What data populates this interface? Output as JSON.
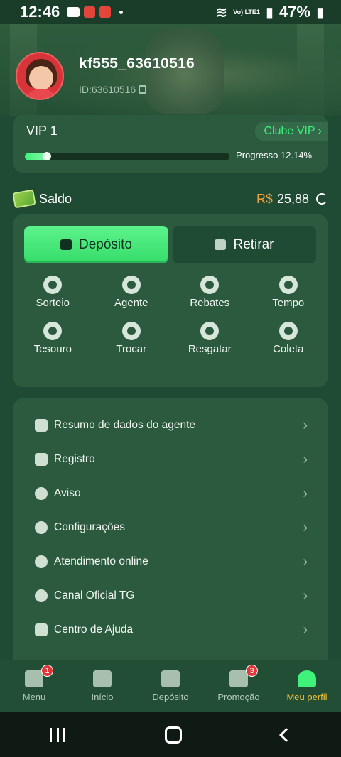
{
  "statusbar": {
    "time": "12:46",
    "network": "Vo) LTE1",
    "battery": "47%"
  },
  "profile": {
    "username": "kf555_63610516",
    "user_id": "ID:63610516"
  },
  "vip": {
    "level": "VIP 1",
    "club_button": "Clube VIP",
    "progress_label": "Progresso 12.14%",
    "progress_fraction": 0.1214
  },
  "saldo": {
    "label": "Saldo",
    "currency": "R$",
    "amount": "25,88"
  },
  "actions": {
    "deposit": "Depósito",
    "withdraw": "Retirar"
  },
  "grid": {
    "items": [
      {
        "label": "Sorteio",
        "icon": "lottery-icon"
      },
      {
        "label": "Agente",
        "icon": "agent-icon"
      },
      {
        "label": "Rebates",
        "icon": "rebate-icon"
      },
      {
        "label": "Tempo",
        "icon": "clock-icon"
      },
      {
        "label": "Tesouro",
        "icon": "treasure-icon"
      },
      {
        "label": "Trocar",
        "icon": "exchange-icon"
      },
      {
        "label": "Resgatar",
        "icon": "coins-icon"
      },
      {
        "label": "Coleta",
        "icon": "collect-icon"
      }
    ]
  },
  "menu": {
    "items": [
      {
        "label": "Resumo de dados do agente",
        "icon": "org-chart-icon"
      },
      {
        "label": "Registro",
        "icon": "edit-document-icon"
      },
      {
        "label": "Aviso",
        "icon": "bell-icon"
      },
      {
        "label": "Configurações",
        "icon": "gear-icon"
      },
      {
        "label": "Atendimento online",
        "icon": "support-agent-icon"
      },
      {
        "label": "Canal Oficial TG",
        "icon": "telegram-icon"
      },
      {
        "label": "Centro de Ajuda",
        "icon": "help-book-icon"
      }
    ]
  },
  "nav": {
    "items": [
      {
        "label": "Menu",
        "icon": "grid-menu-icon",
        "badge": "1"
      },
      {
        "label": "Início",
        "icon": "home-icon"
      },
      {
        "label": "Depósito",
        "icon": "wallet-icon"
      },
      {
        "label": "Promoção",
        "icon": "trophy-icon",
        "badge": "3"
      },
      {
        "label": "Meu perfil",
        "icon": "profile-icon",
        "active": true
      }
    ]
  },
  "colors": {
    "accent": "#3ff27a",
    "background": "#1f4a33",
    "card": "#2b5a3e",
    "currency": "#f3a23a",
    "active_nav": "#f4c233"
  }
}
